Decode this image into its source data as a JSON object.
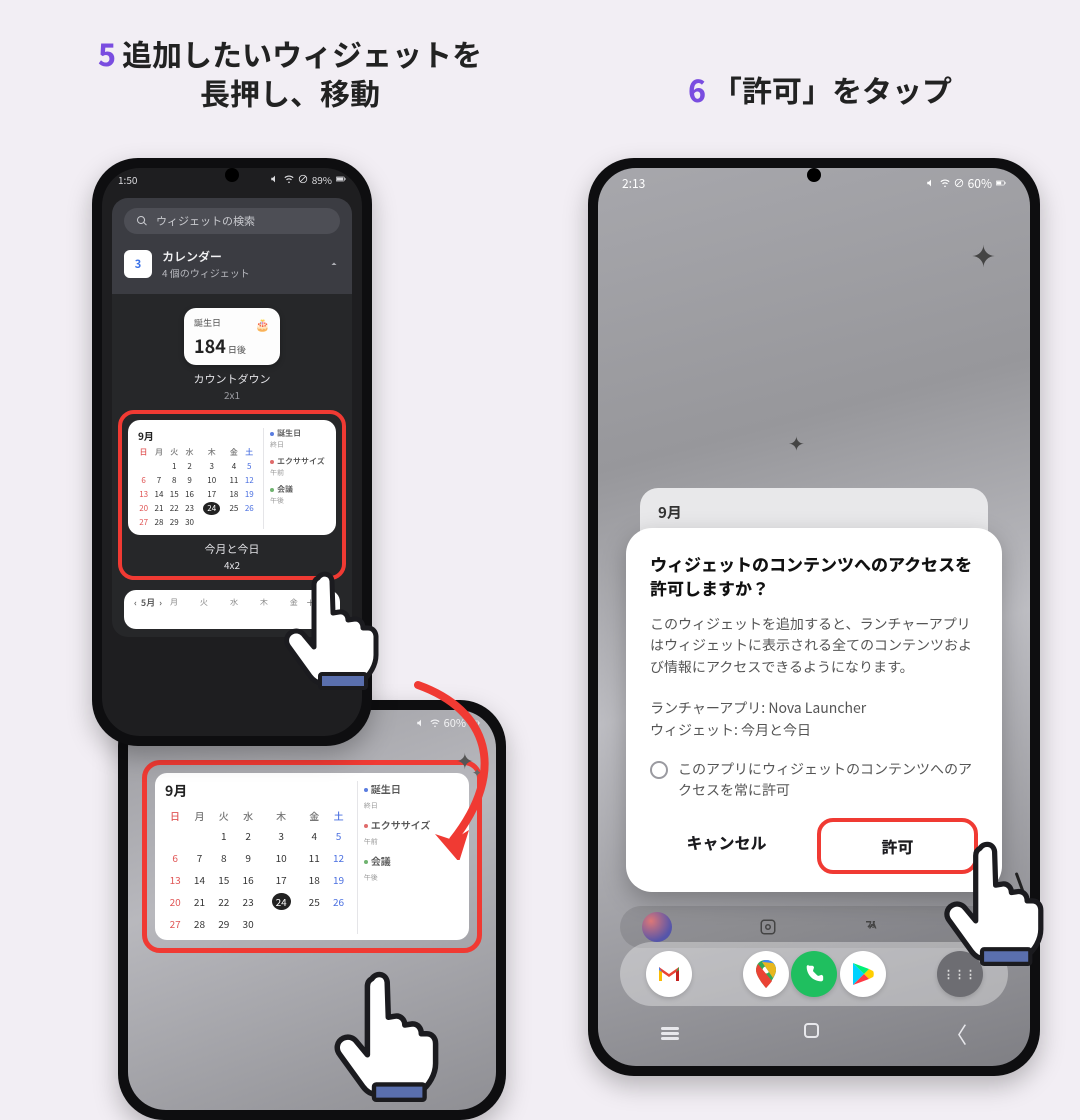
{
  "steps": {
    "s5": {
      "num": "5",
      "text_l1": "追加したいウィジェットを",
      "text_l2": "長押し、移動"
    },
    "s6": {
      "num": "6",
      "text": "「許可」をタップ"
    }
  },
  "phone1": {
    "status": {
      "time": "1:50",
      "battery": "89%"
    },
    "search_placeholder": "ウィジェットの検索",
    "app": {
      "name": "カレンダー",
      "sub": "4 個のウィジェット",
      "icon_day": "3"
    },
    "widget_countdown": {
      "title": "誕生日",
      "value": "184",
      "unit": "日後",
      "label": "カウントダウン",
      "dim": "2x1"
    },
    "widget_month": {
      "label": "今月と今日",
      "dim": "4x2"
    },
    "widget_timeline": {
      "month_nav": "5月"
    }
  },
  "calendar": {
    "month": "9月",
    "dow": [
      "日",
      "月",
      "火",
      "水",
      "木",
      "金",
      "土"
    ],
    "weeks": [
      [
        "",
        "",
        "1",
        "2",
        "3",
        "4",
        "5"
      ],
      [
        "6",
        "7",
        "8",
        "9",
        "10",
        "11",
        "12"
      ],
      [
        "13",
        "14",
        "15",
        "16",
        "17",
        "18",
        "19"
      ],
      [
        "20",
        "21",
        "22",
        "23",
        "24",
        "25",
        "26"
      ],
      [
        "27",
        "28",
        "29",
        "30",
        "",
        "",
        ""
      ]
    ],
    "today": "24",
    "events": [
      {
        "title": "誕生日",
        "sub": "終日",
        "color": "#5a7de0"
      },
      {
        "title": "エクササイズ",
        "sub": "午前",
        "color": "#e06b6b"
      },
      {
        "title": "会議",
        "sub": "午後",
        "color": "#6fb36f"
      }
    ]
  },
  "phone2": {
    "status": {
      "battery": "60%"
    }
  },
  "phone3": {
    "status": {
      "time": "2:13",
      "battery": "60%"
    },
    "peek_month": "9月",
    "dialog": {
      "title": "ウィジェットのコンテンツへのアクセスを許可しますか？",
      "body": "このウィジェットを追加すると、ランチャーアプリはウィジェットに表示される全てのコンテンツおよび情報にアクセスできるようになります。",
      "launcher_label": "ランチャーアプリ: ",
      "launcher_value": "Nova Launcher",
      "widget_label": "ウィジェット: ",
      "widget_value": "今月と今日",
      "checkbox": "このアプリにウィジェットのコンテンツへのアクセスを常に許可",
      "cancel": "キャンセル",
      "allow": "許可"
    }
  }
}
